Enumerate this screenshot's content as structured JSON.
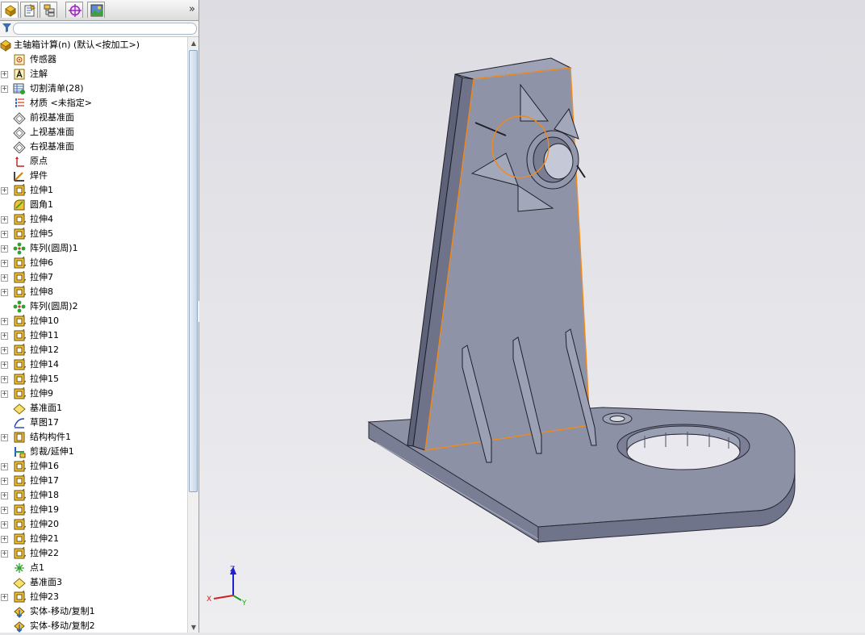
{
  "tabs": [
    {
      "name": "tab-featuremanager",
      "icon": "featuremanager-icon"
    },
    {
      "name": "tab-propertymanager",
      "icon": "propertymanager-icon"
    },
    {
      "name": "tab-configurationmanager",
      "icon": "configurationmanager-icon"
    },
    {
      "name": "tab-dimxpert",
      "icon": "dimxpert-icon"
    },
    {
      "name": "tab-display",
      "icon": "display-manager-icon"
    }
  ],
  "tab_more": "»",
  "tree": {
    "root": "主轴箱计算(n)  (默认<按加工>)",
    "items": [
      {
        "label": "传感器",
        "icon": "sensor-icon",
        "expand": false
      },
      {
        "label": "注解",
        "icon": "annotation-icon",
        "expand": true
      },
      {
        "label": "切割清单(28)",
        "icon": "cutlist-icon",
        "expand": true
      },
      {
        "label": "材质 <未指定>",
        "icon": "material-icon",
        "expand": false
      },
      {
        "label": "前视基准面",
        "icon": "plane-icon",
        "expand": false
      },
      {
        "label": "上视基准面",
        "icon": "plane-icon",
        "expand": false
      },
      {
        "label": "右视基准面",
        "icon": "plane-icon",
        "expand": false
      },
      {
        "label": "原点",
        "icon": "origin-icon",
        "expand": false
      },
      {
        "label": "焊件",
        "icon": "weldment-icon",
        "expand": false
      },
      {
        "label": "拉伸1",
        "icon": "extrude-icon",
        "expand": true
      },
      {
        "label": "圆角1",
        "icon": "fillet-icon",
        "expand": false
      },
      {
        "label": "拉伸4",
        "icon": "extrude-icon",
        "expand": true
      },
      {
        "label": "拉伸5",
        "icon": "extrude-icon",
        "expand": true
      },
      {
        "label": "阵列(圆周)1",
        "icon": "circular-pattern-icon",
        "expand": true
      },
      {
        "label": "拉伸6",
        "icon": "extrude-icon",
        "expand": true
      },
      {
        "label": "拉伸7",
        "icon": "extrude-icon",
        "expand": true
      },
      {
        "label": "拉伸8",
        "icon": "extrude-icon",
        "expand": true
      },
      {
        "label": "阵列(圆周)2",
        "icon": "circular-pattern-icon",
        "expand": false
      },
      {
        "label": "拉伸10",
        "icon": "extrude-icon",
        "expand": true
      },
      {
        "label": "拉伸11",
        "icon": "extrude-icon",
        "expand": true
      },
      {
        "label": "拉伸12",
        "icon": "extrude-icon",
        "expand": true
      },
      {
        "label": "拉伸14",
        "icon": "extrude-icon",
        "expand": true
      },
      {
        "label": "拉伸15",
        "icon": "extrude-icon",
        "expand": true
      },
      {
        "label": "拉伸9",
        "icon": "extrude-icon",
        "expand": true
      },
      {
        "label": "基准面1",
        "icon": "ref-plane-icon",
        "expand": false
      },
      {
        "label": "草图17",
        "icon": "sketch-icon",
        "expand": false
      },
      {
        "label": "结构构件1",
        "icon": "structural-member-icon",
        "expand": true
      },
      {
        "label": "剪裁/延伸1",
        "icon": "trim-extend-icon",
        "expand": false
      },
      {
        "label": "拉伸16",
        "icon": "extrude-icon",
        "expand": true
      },
      {
        "label": "拉伸17",
        "icon": "extrude-icon",
        "expand": true
      },
      {
        "label": "拉伸18",
        "icon": "extrude-icon",
        "expand": true
      },
      {
        "label": "拉伸19",
        "icon": "extrude-icon",
        "expand": true
      },
      {
        "label": "拉伸20",
        "icon": "extrude-icon",
        "expand": true
      },
      {
        "label": "拉伸21",
        "icon": "extrude-icon",
        "expand": true
      },
      {
        "label": "拉伸22",
        "icon": "extrude-icon",
        "expand": true
      },
      {
        "label": "点1",
        "icon": "point-icon",
        "expand": false
      },
      {
        "label": "基准面3",
        "icon": "ref-plane-icon",
        "expand": false
      },
      {
        "label": "拉伸23",
        "icon": "extrude-icon",
        "expand": true
      },
      {
        "label": "实体-移动/复制1",
        "icon": "move-copy-icon",
        "expand": false
      },
      {
        "label": "实体-移动/复制2",
        "icon": "move-copy-icon",
        "expand": false
      }
    ]
  },
  "triad": {
    "x": "X",
    "y": "Y",
    "z": "Z"
  },
  "colors": {
    "model": "#8f93a8",
    "highlight": "#f08a1a",
    "viewport_bg": "#e6e6e9"
  }
}
